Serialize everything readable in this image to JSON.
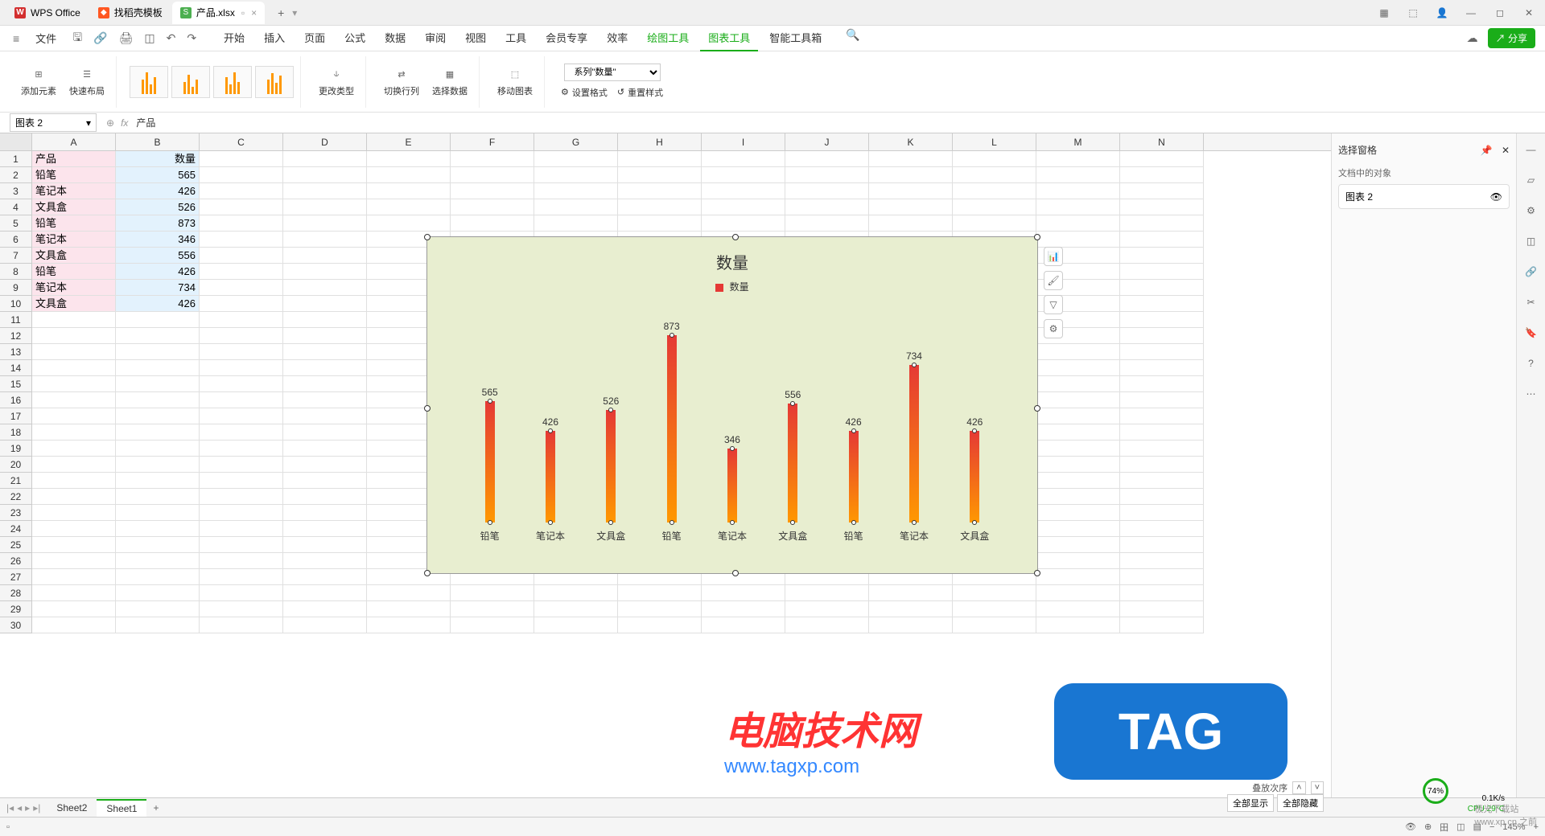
{
  "titlebar": {
    "app_name": "WPS Office",
    "tab_shell": "找稻壳模板",
    "tab_file": "产品.xlsx"
  },
  "menubar": {
    "file": "文件",
    "tabs": [
      "开始",
      "插入",
      "页面",
      "公式",
      "数据",
      "审阅",
      "视图",
      "工具",
      "会员专享",
      "效率",
      "绘图工具",
      "图表工具",
      "智能工具箱"
    ],
    "share": "分享"
  },
  "ribbon": {
    "add_element": "添加元素",
    "quick_layout": "快速布局",
    "change_type": "更改类型",
    "switch_rowcol": "切换行列",
    "select_data": "选择数据",
    "move_chart": "移动图表",
    "series_select": "系列\"数量\"",
    "set_format": "设置格式",
    "reset_style": "重置样式"
  },
  "formula_bar": {
    "name_box": "图表 2",
    "fx": "fx",
    "content": "产品"
  },
  "columns": [
    "A",
    "B",
    "C",
    "D",
    "E",
    "F",
    "G",
    "H",
    "I",
    "J",
    "K",
    "L",
    "M",
    "N"
  ],
  "table": {
    "header": {
      "a": "产品",
      "b": "数量"
    },
    "rows": [
      {
        "a": "铅笔",
        "b": "565"
      },
      {
        "a": "笔记本",
        "b": "426"
      },
      {
        "a": "文具盒",
        "b": "526"
      },
      {
        "a": "铅笔",
        "b": "873"
      },
      {
        "a": "笔记本",
        "b": "346"
      },
      {
        "a": "文具盒",
        "b": "556"
      },
      {
        "a": "铅笔",
        "b": "426"
      },
      {
        "a": "笔记本",
        "b": "734"
      },
      {
        "a": "文具盒",
        "b": "426"
      }
    ]
  },
  "chart_data": {
    "type": "bar",
    "title": "数量",
    "legend": "数量",
    "categories": [
      "铅笔",
      "笔记本",
      "文具盒",
      "铅笔",
      "笔记本",
      "文具盒",
      "铅笔",
      "笔记本",
      "文具盒"
    ],
    "values": [
      565,
      426,
      526,
      873,
      346,
      556,
      426,
      734,
      426
    ],
    "ylim": [
      0,
      900
    ]
  },
  "right_panel": {
    "title": "选择窗格",
    "section": "文档中的对象",
    "item": "图表 2",
    "sort_label": "叠放次序",
    "show_all": "全部显示",
    "hide_all": "全部隐藏"
  },
  "sheets": {
    "sheet2": "Sheet2",
    "sheet1": "Sheet1"
  },
  "status": {
    "zoom": "145%",
    "zoom_circle": "74%",
    "net_speed": "0.1K/s",
    "cpu": "CPU 29°C"
  },
  "watermark": {
    "text1": "电脑技术网",
    "text2": "www.tagxp.com",
    "tag": "TAG",
    "dl": "极光下载站",
    "dl_url": "www.xp.cn 之前"
  }
}
